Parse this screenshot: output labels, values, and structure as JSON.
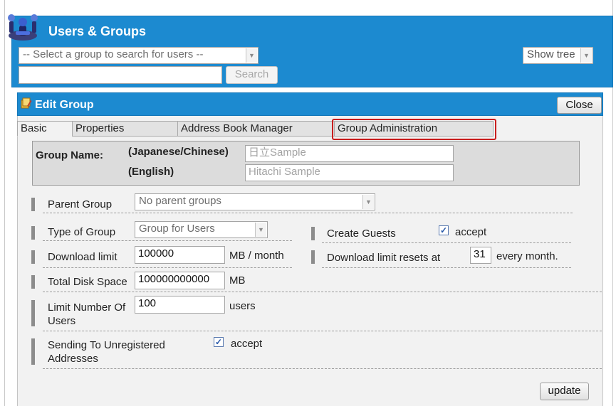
{
  "app": {
    "title": "Users & Groups"
  },
  "search": {
    "group_select": "-- Select a group to search for users --",
    "search_value": "",
    "search_button": "Search",
    "show_tree": "Show tree"
  },
  "edit_group": {
    "title": "Edit Group",
    "close_button": "Close",
    "tabs": [
      {
        "label": "Basic"
      },
      {
        "label": "Properties"
      },
      {
        "label": "Address Book Manager"
      },
      {
        "label": "Group Administration"
      }
    ],
    "group_name": {
      "label": "Group Name:",
      "japanese_label": "(Japanese/Chinese)",
      "english_label": "(English)",
      "japanese_placeholder": "日立Sample",
      "english_placeholder": "Hitachi Sample"
    },
    "parent_group": {
      "label": "Parent Group",
      "value": "No parent groups"
    },
    "type_of_group": {
      "label": "Type of Group",
      "value": "Group for Users"
    },
    "create_guests": {
      "label": "Create Guests",
      "checkbox_label": "accept",
      "checked": true
    },
    "download_limit": {
      "label": "Download limit",
      "value": "100000",
      "unit": "MB / month"
    },
    "download_reset": {
      "label": "Download limit resets at",
      "value": "31",
      "suffix": "every month."
    },
    "total_disk": {
      "label": "Total Disk Space",
      "value": "100000000000",
      "unit": "MB"
    },
    "limit_users": {
      "label_line1": "Limit Number Of",
      "label_line2": "Users",
      "value": "100",
      "unit": "users"
    },
    "sending_unregistered": {
      "label_line1": "Sending To Unregistered",
      "label_line2": "Addresses",
      "checkbox_label": "accept",
      "checked": true
    },
    "update_button": "update"
  },
  "colors": {
    "header_blue": "#1c8ad0",
    "highlight_red": "#c81e1e",
    "panel_gray": "#f2f2f2"
  }
}
